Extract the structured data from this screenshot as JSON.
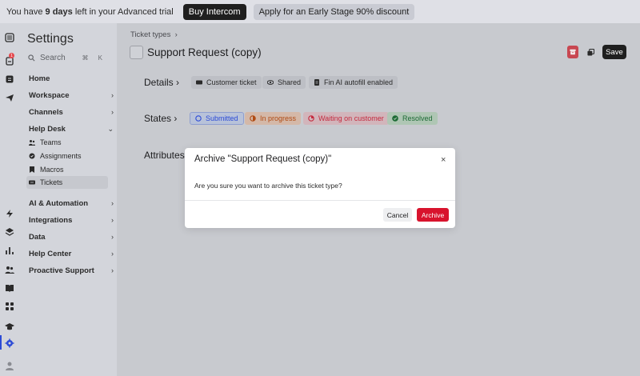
{
  "banner": {
    "text_prefix": "You have ",
    "text_days": "9 days",
    "text_suffix": " left in your Advanced trial",
    "buy_label": "Buy Intercom",
    "apply_label": "Apply for an Early Stage 90% discount"
  },
  "rail": {
    "badge": "1",
    "icons": [
      "inbox-icon",
      "notification-icon",
      "reports-icon",
      "outbound-icon",
      "lightning-icon",
      "layers-icon",
      "bar-chart-icon",
      "contacts-icon",
      "book-icon",
      "apps-icon",
      "academy-icon",
      "settings-icon",
      "avatar-icon"
    ]
  },
  "settings": {
    "title": "Settings",
    "search_placeholder": "Search",
    "search_kbd": "⌘ K",
    "items": [
      {
        "label": "Home",
        "chevron": ""
      },
      {
        "label": "Workspace",
        "chevron": "›"
      },
      {
        "label": "Channels",
        "chevron": "›"
      },
      {
        "label": "Help Desk",
        "chevron": "⌄"
      },
      {
        "label": "AI & Automation",
        "chevron": "›"
      },
      {
        "label": "Integrations",
        "chevron": "›"
      },
      {
        "label": "Data",
        "chevron": "›"
      },
      {
        "label": "Help Center",
        "chevron": "›"
      },
      {
        "label": "Proactive Support",
        "chevron": "›"
      }
    ],
    "helpdesk_sub": [
      {
        "label": "Teams",
        "icon": "teams-icon"
      },
      {
        "label": "Assignments",
        "icon": "assignments-icon"
      },
      {
        "label": "Macros",
        "icon": "macros-icon"
      },
      {
        "label": "Tickets",
        "icon": "tickets-icon"
      }
    ]
  },
  "main": {
    "breadcrumb": "Ticket types",
    "breadcrumb_sep": "›",
    "title": "Support Request (copy)",
    "save_label": "Save",
    "details": {
      "label": "Details",
      "chevron": "›",
      "chips": [
        "Customer ticket",
        "Shared",
        "Fin AI autofill enabled"
      ]
    },
    "states": {
      "label": "States",
      "chevron": "›",
      "chips": [
        "Submitted",
        "In progress",
        "Waiting on customer",
        "Resolved"
      ]
    },
    "attributes": {
      "label": "Attributes"
    }
  },
  "modal": {
    "title": "Archive \"Support Request (copy)\"",
    "close": "×",
    "body": "Are you sure you want to archive this ticket type?",
    "cancel_label": "Cancel",
    "archive_label": "Archive"
  },
  "colors": {
    "accent": "#2c4bd6",
    "danger": "#d8132d",
    "dark": "#1f1f1f"
  }
}
